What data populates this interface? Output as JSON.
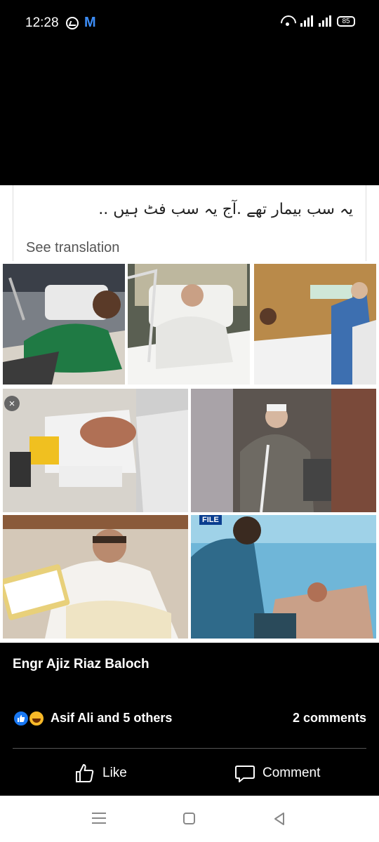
{
  "status_bar": {
    "time": "12:28",
    "app_letter": "M",
    "battery": "85"
  },
  "post": {
    "caption_urdu": "یہ سب بیمار تھے .آج یہ سب فٹ ہیں ..",
    "see_translation": "See translation",
    "file_tag": "FILE",
    "author": "Engr Ajiz Riaz Baloch",
    "reactors": "Asif Ali and 5 others",
    "comments": "2 comments"
  },
  "actions": {
    "like_label": "Like",
    "comment_label": "Comment"
  },
  "icons": {
    "message": "messenger-icon",
    "wifi": "wifi-icon",
    "signal": "signal-icon",
    "battery": "battery-icon",
    "like": "thumbs-up-icon",
    "comment": "speech-bubble-icon",
    "close": "close-icon",
    "menu": "menu-icon",
    "home": "home-icon",
    "back": "back-icon"
  },
  "colors": {
    "background": "#000000",
    "accent": "#1877f2",
    "haha": "#f7b928"
  }
}
